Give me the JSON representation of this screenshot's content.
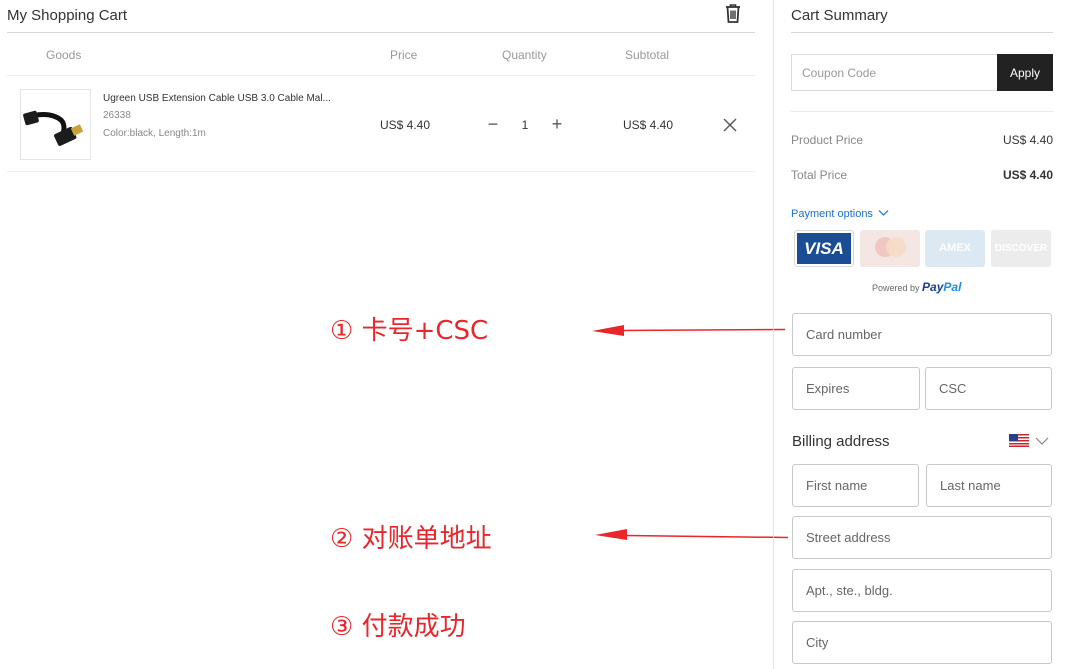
{
  "cart": {
    "title": "My Shopping Cart",
    "columns": {
      "goods": "Goods",
      "price": "Price",
      "quantity": "Quantity",
      "subtotal": "Subtotal"
    },
    "item": {
      "name": "Ugreen USB Extension Cable USB 3.0 Cable Mal...",
      "sku": "26338",
      "attributes": "Color:black, Length:1m",
      "price": "US$ 4.40",
      "quantity": "1",
      "subtotal": "US$ 4.40"
    },
    "qty_minus": "−",
    "qty_plus": "+"
  },
  "annotations": {
    "step1": "①  卡号+CSC",
    "step2": "②  对账单地址",
    "step3": "③  付款成功",
    "color": "#e8262b"
  },
  "summary": {
    "title": "Cart Summary",
    "coupon_placeholder": "Coupon Code",
    "apply_label": "Apply",
    "product_price_label": "Product Price",
    "product_price_value": "US$ 4.40",
    "total_price_label": "Total Price",
    "total_price_value": "US$ 4.40",
    "payment_options_label": "Payment options",
    "cards": [
      "VISA",
      "MasterCard",
      "AMEX",
      "DISCOVER"
    ],
    "powered_by": "Powered by",
    "powered_brand_a": "Pay",
    "powered_brand_b": "Pal",
    "card_number_placeholder": "Card number",
    "expires_placeholder": "Expires",
    "csc_placeholder": "CSC",
    "billing_title": "Billing address",
    "first_name_placeholder": "First name",
    "last_name_placeholder": "Last name",
    "street_placeholder": "Street address",
    "apt_placeholder": "Apt., ste., bldg.",
    "city_placeholder": "City"
  },
  "colors": {
    "accent_link": "#1a73c9",
    "apply_bg": "#222222",
    "visa_blue": "#1a4d94"
  }
}
